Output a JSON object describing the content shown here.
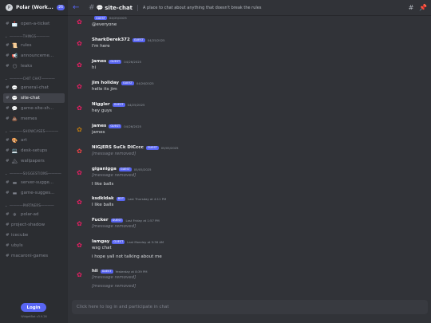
{
  "server": {
    "name": "Polar (Work...",
    "badge": "26",
    "icon": "server-icon-glyph",
    "icon_glyph": "P"
  },
  "sidebar": {
    "items": [
      {
        "kind": "channel",
        "emoji": "📩",
        "name": "open-a-ticket",
        "active": false
      },
      {
        "kind": "category",
        "name": "THINGS"
      },
      {
        "kind": "channel",
        "emoji": "📜",
        "name": "rules",
        "active": false
      },
      {
        "kind": "channel",
        "emoji": "📢",
        "name": "announceme...",
        "active": false
      },
      {
        "kind": "channel",
        "emoji": "😶",
        "name": "leaks",
        "active": false
      },
      {
        "kind": "category",
        "name": "CHIT CHAT"
      },
      {
        "kind": "channel",
        "emoji": "💬",
        "name": "general-chat",
        "active": false
      },
      {
        "kind": "channel",
        "emoji": "💬",
        "name": "site-chat",
        "active": true
      },
      {
        "kind": "channel",
        "emoji": "💬",
        "name": "game-site-sh...",
        "active": false
      },
      {
        "kind": "channel",
        "emoji": "💩",
        "name": "memes",
        "active": false
      },
      {
        "kind": "category",
        "name": "SHOWCASES"
      },
      {
        "kind": "channel",
        "emoji": "🎨",
        "name": "art",
        "active": false
      },
      {
        "kind": "channel",
        "emoji": "💻",
        "name": "desk-setups",
        "active": false
      },
      {
        "kind": "channel",
        "emoji": "🏔",
        "name": "wallpapers",
        "active": false
      },
      {
        "kind": "category",
        "name": "SUGGESTIONS"
      },
      {
        "kind": "channel",
        "emoji": "▬",
        "name": "server-sugge...",
        "active": false
      },
      {
        "kind": "channel",
        "emoji": "▬",
        "name": "game-sugges...",
        "active": false
      },
      {
        "kind": "category",
        "name": "PARTNERS"
      },
      {
        "kind": "channel",
        "emoji": "❄",
        "name": "polar-ad",
        "active": false
      },
      {
        "kind": "channel",
        "emoji": "",
        "name": "project-shadow",
        "active": false
      },
      {
        "kind": "channel",
        "emoji": "",
        "name": "icecube",
        "active": false
      },
      {
        "kind": "channel",
        "emoji": "",
        "name": "ubyls",
        "active": false
      },
      {
        "kind": "channel",
        "emoji": "",
        "name": "macaroni-games",
        "active": false
      }
    ],
    "login_label": "Login",
    "widget_version": "WidgetBot v3.9.26"
  },
  "header": {
    "channel_emoji": "💬",
    "channel_name": "site-chat",
    "topic": "A place to chat about anything that doesn't break the rules",
    "hash_glyph": "#",
    "back_glyph": "←",
    "threads_glyph": "#",
    "pin_glyph": "📌"
  },
  "messages": [
    {
      "user": "",
      "tag": "GUEST",
      "time": "04/25/2025",
      "avatar": "pink",
      "lines": [
        "@everyone"
      ],
      "removed": [
        false
      ]
    },
    {
      "user": "SharkDerek372",
      "tag": "GUEST",
      "time": "04/25/2025",
      "avatar": "pink",
      "lines": [
        "I'm here"
      ],
      "removed": [
        false
      ]
    },
    {
      "user": "james",
      "tag": "GUEST",
      "time": "04/26/2025",
      "avatar": "pink",
      "lines": [
        "hi"
      ],
      "removed": [
        false
      ]
    },
    {
      "user": "jim holiday",
      "tag": "GUEST",
      "time": "04/26/2025",
      "avatar": "pink",
      "lines": [
        "hello its jim"
      ],
      "removed": [
        false
      ]
    },
    {
      "user": "Niggler",
      "tag": "GUEST",
      "time": "04/25/2025",
      "avatar": "pink",
      "lines": [
        "hey guys"
      ],
      "removed": [
        false
      ]
    },
    {
      "user": "james",
      "tag": "GUEST",
      "time": "04/26/2025",
      "avatar": "orange",
      "lines": [
        "james"
      ],
      "removed": [
        false
      ]
    },
    {
      "user": "NIGjERS SuCk DICccc",
      "tag": "GUEST",
      "time": "05/05/2025",
      "avatar": "red",
      "lines": [
        "[message removed]"
      ],
      "removed": [
        true
      ]
    },
    {
      "user": "giganigga",
      "tag": "GUEST",
      "time": "05/05/2025",
      "avatar": "pink",
      "lines": [
        "[message removed]",
        "I like balls"
      ],
      "removed": [
        true,
        false
      ]
    },
    {
      "user": "ksdkldak",
      "tag": "BOT",
      "time": "Last Thursday at 4:11 PM",
      "avatar": "pink",
      "lines": [
        "I like balls"
      ],
      "removed": [
        false
      ]
    },
    {
      "user": "Fucker",
      "tag": "GUEST",
      "time": "Last Friday at 1:57 PM",
      "avatar": "pink",
      "lines": [
        "[message removed]"
      ],
      "removed": [
        true
      ]
    },
    {
      "user": "lamgay",
      "tag": "GUEST",
      "time": "Last Monday at 5:36 AM",
      "avatar": "pink",
      "lines": [
        "wsg chat",
        "i hope yall not talking about me"
      ],
      "removed": [
        false,
        false
      ]
    },
    {
      "user": "hii",
      "tag": "GUEST",
      "time": "Yesterday at 8:39 PM",
      "avatar": "pink",
      "lines": [
        "[message removed]",
        "[message removed]"
      ],
      "removed": [
        true,
        true
      ]
    }
  ],
  "composer": {
    "placeholder": "Click here to log in and participate in chat"
  },
  "colors": {
    "accent": "#5865f2",
    "avatar_pink": "#e91e63",
    "avatar_orange": "#c27c0e",
    "avatar_red": "#ed4245"
  }
}
